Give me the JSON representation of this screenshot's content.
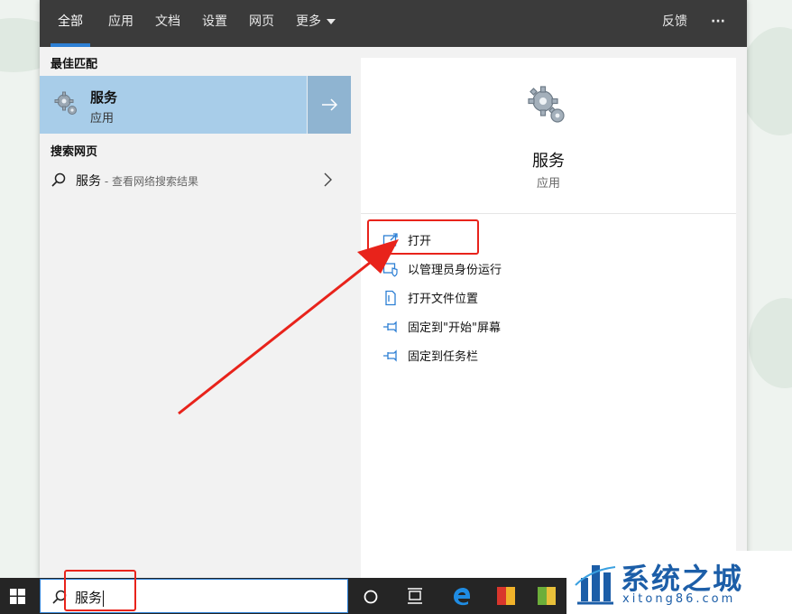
{
  "tabs": [
    {
      "label": "全部"
    },
    {
      "label": "应用"
    },
    {
      "label": "文档"
    },
    {
      "label": "设置"
    },
    {
      "label": "网页"
    },
    {
      "label": "更多"
    }
  ],
  "topbar": {
    "feedback": "反馈",
    "more_dots": "···"
  },
  "best_match": {
    "section": "最佳匹配",
    "title": "服务",
    "subtitle": "应用"
  },
  "web": {
    "section": "搜索网页",
    "query": "服务",
    "suffix": " - 查看网络搜索结果"
  },
  "detail": {
    "title": "服务",
    "subtitle": "应用",
    "actions": [
      {
        "label": "打开",
        "icon": "open-icon"
      },
      {
        "label": "以管理员身份运行",
        "icon": "admin-shield-icon"
      },
      {
        "label": "打开文件位置",
        "icon": "file-location-icon"
      },
      {
        "label": "固定到\"开始\"屏幕",
        "icon": "pin-icon"
      },
      {
        "label": "固定到任务栏",
        "icon": "pin-icon"
      }
    ]
  },
  "search": {
    "value": "服务"
  },
  "watermark": {
    "text": "系统之城",
    "url": "xitong86.com"
  },
  "colors": {
    "accent": "#2d7fd4",
    "selected": "#a8cde9",
    "annotation": "#e8231b",
    "topbar": "#3b3b3b"
  }
}
